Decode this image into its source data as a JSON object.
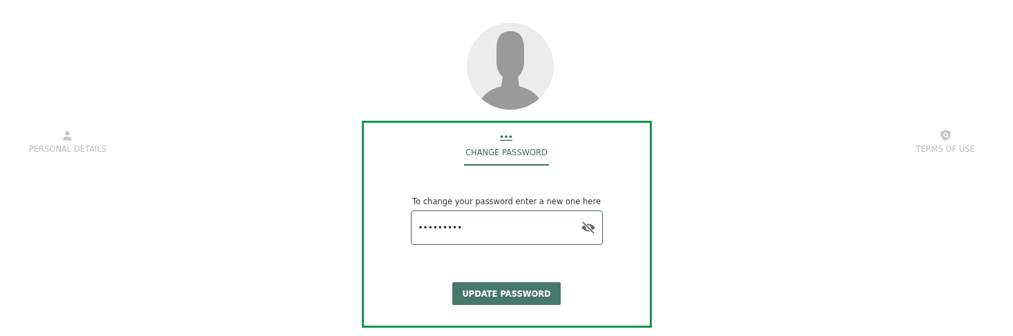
{
  "tabs": [
    {
      "label": "PERSONAL DETAILS",
      "selected": false
    },
    {
      "label": "CHANGE PASSWORD",
      "selected": true
    },
    {
      "label": "TERMS OF USE",
      "selected": false
    }
  ],
  "form": {
    "label": "To change your password enter a new one here",
    "value": "•••••••••",
    "button": "UPDATE PASSWORD"
  }
}
